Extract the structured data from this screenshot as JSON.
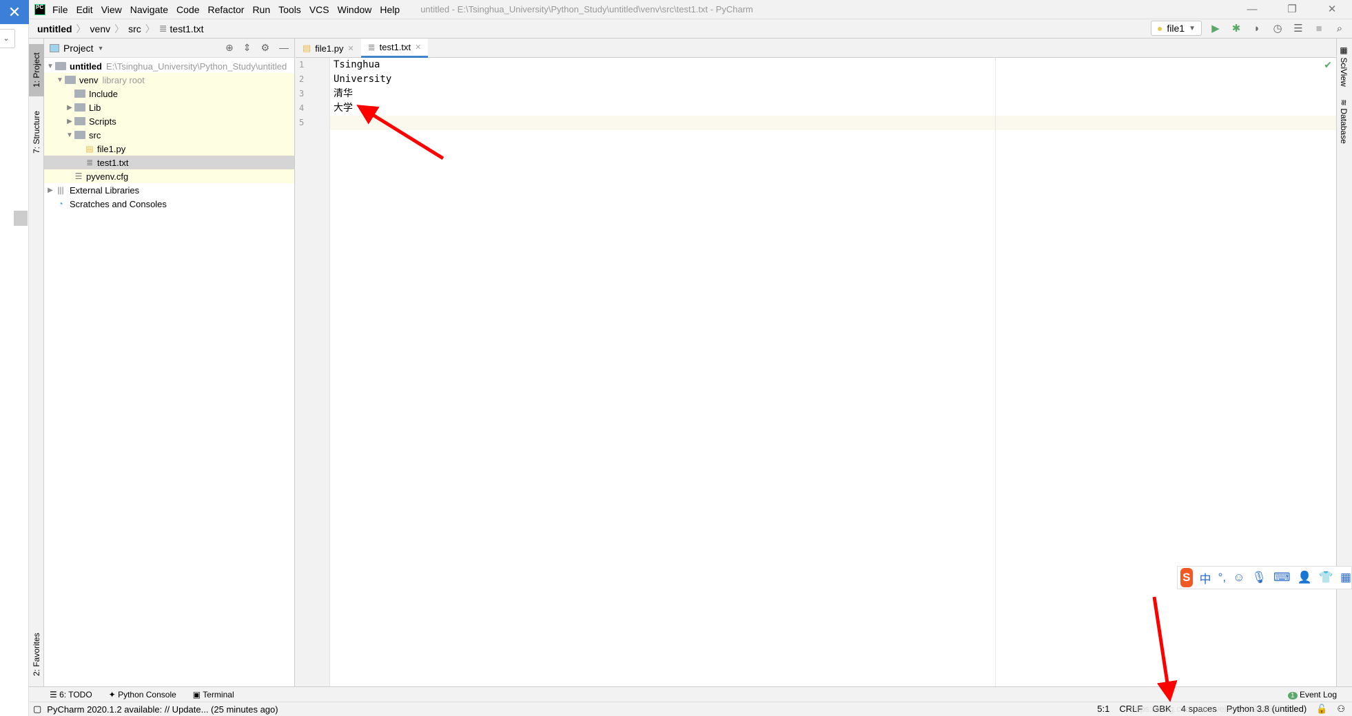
{
  "left_window": {
    "close_icon": "close-icon"
  },
  "menu": {
    "items": [
      "File",
      "Edit",
      "View",
      "Navigate",
      "Code",
      "Refactor",
      "Run",
      "Tools",
      "VCS",
      "Window",
      "Help"
    ],
    "window_title": "untitled - E:\\Tsinghua_University\\Python_Study\\untitled\\venv\\src\\test1.txt - PyCharm"
  },
  "breadcrumb": [
    "untitled",
    "venv",
    "src",
    "test1.txt"
  ],
  "run_config": "file1",
  "left_strip": {
    "project": "1: Project",
    "structure": "7: Structure",
    "favorites": "2: Favorites"
  },
  "project": {
    "title": "Project",
    "tree": [
      {
        "label": "untitled",
        "hint": "E:\\Tsinghua_University\\Python_Study\\untitled"
      },
      {
        "label": "venv",
        "hint": "library root"
      },
      {
        "label": "Include"
      },
      {
        "label": "Lib"
      },
      {
        "label": "Scripts"
      },
      {
        "label": "src"
      },
      {
        "label": "file1.py"
      },
      {
        "label": "test1.txt"
      },
      {
        "label": "pyvenv.cfg"
      },
      {
        "label": "External Libraries"
      },
      {
        "label": "Scratches and Consoles"
      }
    ]
  },
  "tabs": [
    {
      "label": "file1.py"
    },
    {
      "label": "test1.txt",
      "active": true
    }
  ],
  "editor": {
    "line_numbers": [
      "1",
      "2",
      "3",
      "4",
      "5"
    ],
    "lines": [
      "Tsinghua",
      "University",
      "清华",
      "大学",
      ""
    ]
  },
  "right_strip": {
    "sciview": "SciView",
    "database": "Database"
  },
  "bottom_tools": {
    "todo": "6: TODO",
    "console": "Python Console",
    "terminal": "Terminal",
    "event_log": "Event Log",
    "event_count": "1"
  },
  "status": {
    "message": "PyCharm 2020.1.2 available: // Update... (25 minutes ago)",
    "position": "5:1",
    "line_sep": "CRLF",
    "encoding": "GBK",
    "indent": "4 spaces",
    "interpreter": "Python 3.8 (untitled)"
  },
  "ime": {
    "logo": "S",
    "mode": "中",
    "punct": "°,"
  },
  "watermark": "https://blog.csdn.net/weixin_43949535",
  "colors": {
    "accent": "#4083c9",
    "annotation_arrow": "#ff0000",
    "run_green": "#59a869"
  }
}
